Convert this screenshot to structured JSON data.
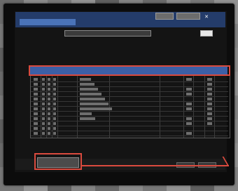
{
  "window": {
    "title": "",
    "tab_label": "",
    "top_buttons": [
      "",
      ""
    ],
    "close_symbol": "✕"
  },
  "toolbar": {
    "label": "",
    "filter_value": "",
    "count_text": "",
    "apply_label": ""
  },
  "table": {
    "selected_row": [
      "",
      "",
      "",
      ""
    ]
  },
  "footer": {
    "back_label": ""
  },
  "colors": {
    "accent": "#3c5fa6",
    "annotation": "#d94a3e"
  }
}
